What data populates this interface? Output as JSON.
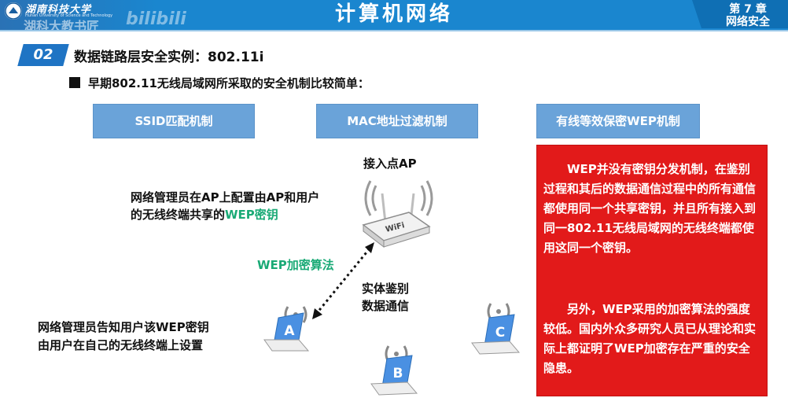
{
  "header": {
    "university_cn": "湖南科技大学",
    "university_en": "Hunan University of Science and Technology",
    "watermark": "湖科大教书匠",
    "watermark_logo": "bilibili",
    "course_title": "计算机网络",
    "chapter_number": "第 7 章",
    "chapter_name": "网络安全"
  },
  "section": {
    "number": "02",
    "title": "数据链路层安全实例：802.11i"
  },
  "intro": "早期802.11无线局域网所采取的安全机制比较简单：",
  "mechanisms": [
    "SSID匹配机制",
    "MAC地址过滤机制",
    "有线等效保密WEP机制"
  ],
  "diagram": {
    "ap_label": "接入点AP",
    "ap_device_text": "WiFi",
    "admin_config_line1": "网络管理员在AP上配置由AP和用户",
    "admin_config_line2_prefix": "的无线终端共享的",
    "admin_config_line2_highlight": "WEP密钥",
    "wep_algorithm": "WEP加密算法",
    "auth_line1": "实体鉴别",
    "auth_line2": "数据通信",
    "admin_tell_line1": "网络管理员告知用户该WEP密钥",
    "admin_tell_line2": "由用户在自己的无线终端上设置",
    "terminals": [
      "A",
      "B",
      "C"
    ]
  },
  "note": {
    "paragraph1": "WEP并没有密钥分发机制，在鉴别过程和其后的数据通信过程中的所有通信都使用同一个共享密钥，并且所有接入到同一802.11无线局域网的无线终端都使用这同一个密钥。",
    "paragraph2": "另外，WEP采用的加密算法的强度较低。国内外众多研究人员已从理论和实际上都证明了WEP加密存在严重的安全隐患。"
  },
  "colors": {
    "header_blue": "#1a86cf",
    "box_blue": "#6aa3d9",
    "note_red": "#e21a1a",
    "highlight_green": "#1aaa76",
    "laptop_blue": "#4a90e2"
  }
}
